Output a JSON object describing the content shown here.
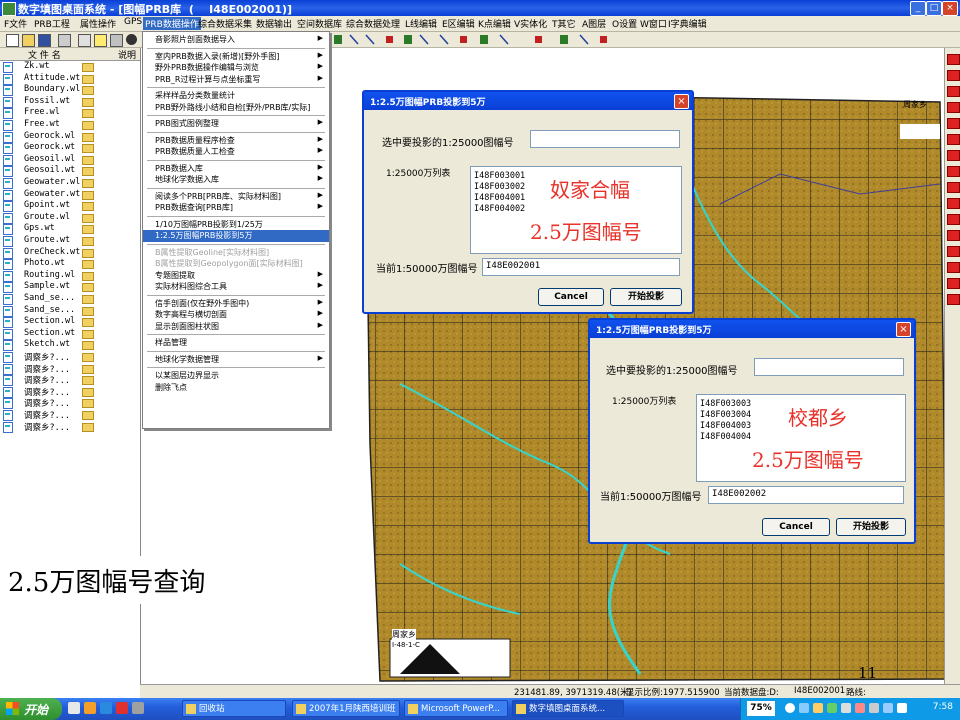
{
  "window": {
    "title": "数字填图桌面系统 - [图幅PRB库  (    I48E002001)]"
  },
  "menubar": {
    "items": [
      "F文件",
      "PRB工程",
      "属性操作",
      "GPS",
      "PRB数据操作",
      "综合数据采集",
      "数据输出",
      "空间数据库",
      "综合数据处理",
      "L线编辑",
      "E区编辑",
      "K点编辑",
      "V实体化",
      "T其它",
      "A图层",
      "O设置",
      "W窗口",
      "I字典编辑"
    ]
  },
  "left_panel": {
    "col_file": "文 件 名",
    "col_desc": "说明",
    "files": [
      "Zk.wt",
      "Attitude.wt",
      "Boundary.wl",
      "Fossil.wt",
      "Free.wl",
      "Free.wt",
      "Georock.wl",
      "Georock.wt",
      "Geosoil.wl",
      "Geosoil.wt",
      "Geowater.wl",
      "Geowater.wt",
      "Gpoint.wt",
      "Groute.wl",
      "Gps.wt",
      "Groute.wt",
      "OreCheck.wt",
      "Photo.wt",
      "Routing.wl",
      "Sample.wt",
      "Sand_se...",
      "Sand_se...",
      "Section.wl",
      "Section.wt",
      "Sketch.wt",
      "调察乡?...",
      "调察乡?...",
      "调察乡?...",
      "调察乡?...",
      "调察乡?...",
      "调察乡?...",
      "调察乡?..."
    ]
  },
  "dropdown": {
    "items": [
      {
        "label": "音影照片剖面数据导入",
        "arrow": true
      },
      {
        "sep": true
      },
      {
        "label": "室内PRB数据入录(新增)[野外手图]",
        "arrow": true
      },
      {
        "label": "野外PRB数据操作编辑与浏览",
        "arrow": true
      },
      {
        "label": "PRB_R过程计算与点坐标重写",
        "arrow": true
      },
      {
        "sep": true
      },
      {
        "label": "采样样品分类数量统计",
        "arrow": false
      },
      {
        "label": "PRB野外路线小结和自检[野外/PRB库/实际]",
        "arrow": false
      },
      {
        "sep": true
      },
      {
        "label": "PRB图式图例整理",
        "arrow": true
      },
      {
        "sep": true
      },
      {
        "label": "PRB数据质量程序检查",
        "arrow": true
      },
      {
        "label": "PRB数据质量人工检查",
        "arrow": true
      },
      {
        "sep": true
      },
      {
        "label": "PRB数据入库",
        "arrow": true
      },
      {
        "label": "地球化学数据入库",
        "arrow": true
      },
      {
        "sep": true
      },
      {
        "label": "阅读多个PRB[PRB库、实际材料图]",
        "arrow": true
      },
      {
        "label": "PRB数据查询[PRB库]",
        "arrow": true
      },
      {
        "sep": true
      },
      {
        "label": "1/10万图幅PRB投影到1/25万",
        "arrow": false
      },
      {
        "label": "1:2.5万图幅PRB投影到5万",
        "arrow": false,
        "highlight": true
      },
      {
        "sep": true
      },
      {
        "label": "B属性提取Geoline[实际材料图]",
        "arrow": false,
        "disabled": true
      },
      {
        "label": "B属性提取到Geopolygon面[实际材料图]",
        "arrow": false,
        "disabled": true
      },
      {
        "label": "专题图提取",
        "arrow": true
      },
      {
        "label": "实际材料图综合工具",
        "arrow": true
      },
      {
        "sep": true
      },
      {
        "label": "信手剖面(仅在野外手图中)",
        "arrow": true
      },
      {
        "label": "数字高程与横切剖面",
        "arrow": true
      },
      {
        "label": "显示剖面图柱状图",
        "arrow": true
      },
      {
        "sep": true
      },
      {
        "label": "样品管理",
        "arrow": false
      },
      {
        "sep": true
      },
      {
        "label": "地球化学数据管理",
        "arrow": true
      },
      {
        "sep": true
      },
      {
        "label": "以某图层边界显示",
        "arrow": false
      },
      {
        "label": "删除飞点",
        "arrow": false
      }
    ]
  },
  "dialog1": {
    "title": "1:2.5万图幅PRB投影到5万",
    "select_label": "选中要投影的1:25000图幅号",
    "select_value": "",
    "list_label": "1:25000万列表",
    "list_items": [
      "I48F003001",
      "I48F003002",
      "I48F004001",
      "I48F004002"
    ],
    "current_label": "当前1:50000万图幅号",
    "current_value": "I48E002001",
    "cancel": "Cancel",
    "start": "开始投影",
    "annotation_line1": "奴家合幅",
    "annotation_line2": "2.5万图幅号"
  },
  "dialog2": {
    "title": "1:2.5万图幅PRB投影到5万",
    "select_label": "选中要投影的1:25000图幅号",
    "select_value": "",
    "list_label": "1:25000万列表",
    "list_items": [
      "I48F003003",
      "I48F003004",
      "I48F004003",
      "I48F004004"
    ],
    "current_label": "当前1:50000万图幅号",
    "current_value": "I48E002002",
    "cancel": "Cancel",
    "start": "开始投影",
    "annotation_line1": "校都乡",
    "annotation_line2": "2.5万图幅号"
  },
  "map": {
    "label_top_right": "周家乡",
    "label_bottom_left": "周家乡",
    "label_sheet": "I-48-1-C"
  },
  "caption": "2.5万图幅号查询",
  "page_number": "11",
  "statusbar": {
    "coords": "231481.89, 3971319.48(米)",
    "scale": "显示比例:1977.515900",
    "layer": "当前数据盘:D:",
    "sheet": "I48E002001",
    "route": "路线:"
  },
  "taskbar": {
    "start": "开始",
    "tasks": [
      "回收站",
      "2007年1月陕西培训班",
      "Microsoft PowerP...",
      "数字填图桌面系统..."
    ],
    "zoom": "75%",
    "clock": "7:58"
  },
  "colors": {
    "map_fill": "#b08a2a",
    "title_blue": "#0a3fd6",
    "highlight": "#316ac5",
    "annotation_red": "#e8322a"
  }
}
